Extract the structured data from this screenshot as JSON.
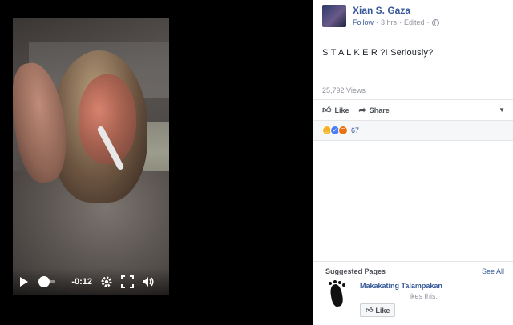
{
  "post": {
    "author": "Xian S. Gaza",
    "follow_label": "Follow",
    "time": "3 hrs",
    "edited": "Edited",
    "text": "S T A L K E R ?! Seriously?",
    "views": "25,792 Views"
  },
  "actions": {
    "like": "Like",
    "share": "Share"
  },
  "reactions": {
    "icons": [
      "haha-icon",
      "like-icon",
      "angry-icon"
    ],
    "count": "67"
  },
  "video": {
    "time_remaining": "-0:12",
    "progress_fraction": 0.0
  },
  "suggested": {
    "title": "Suggested Pages",
    "see_all": "See All",
    "page_name": "Makakating Talampakan",
    "likes_text": "ikes this.",
    "like_button": "Like"
  },
  "colors": {
    "link": "#365899",
    "muted": "#90949c",
    "bg_dark": "#000000"
  }
}
